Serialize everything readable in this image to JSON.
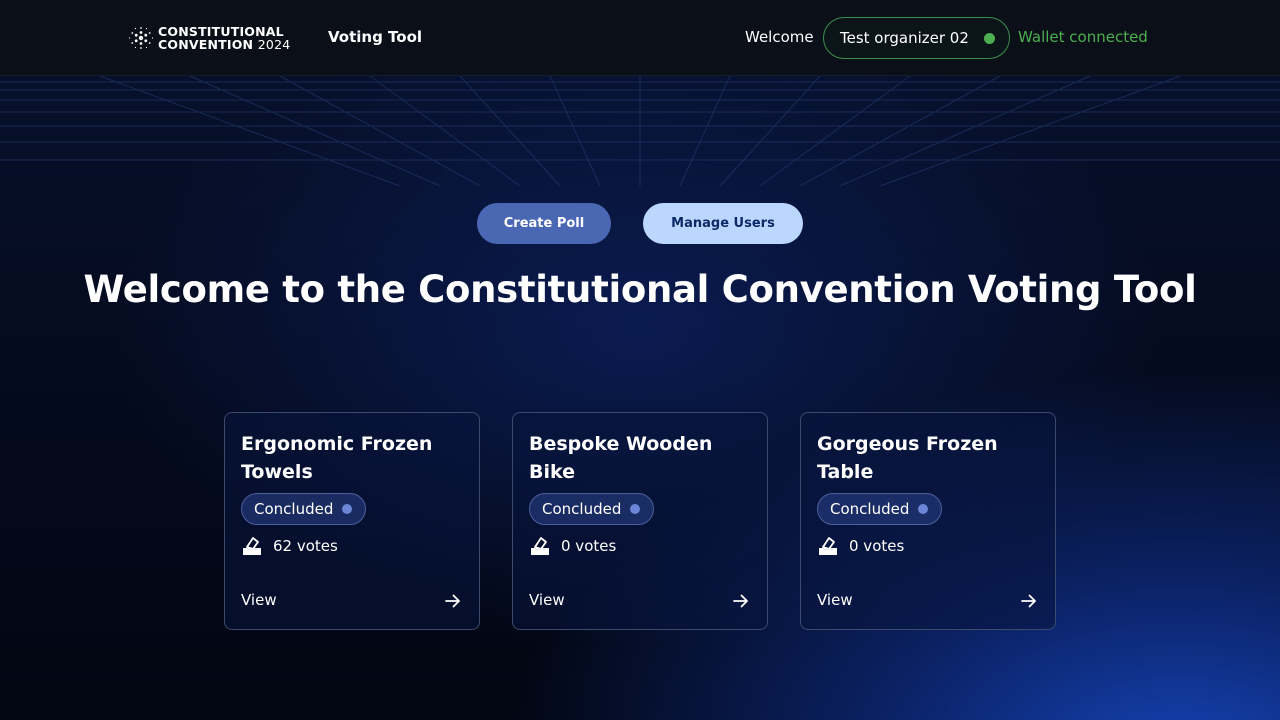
{
  "header": {
    "logo_line1": "CONSTITUTIONAL",
    "logo_line2": "CONVENTION",
    "logo_year": "2024",
    "logo_icon": "cardano-dots-icon",
    "app_title": "Voting Tool",
    "welcome_label": "Welcome",
    "user_name": "Test organizer 02",
    "wallet_status": "Wallet connected"
  },
  "actions": {
    "create_poll": "Create Poll",
    "manage_users": "Manage Users"
  },
  "main": {
    "heading": "Welcome to the Constitutional Convention Voting Tool"
  },
  "polls": [
    {
      "title": "Ergonomic Frozen Towels",
      "status": "Concluded",
      "votes": "62 votes",
      "view_label": "View"
    },
    {
      "title": "Bespoke Wooden Bike",
      "status": "Concluded",
      "votes": "0 votes",
      "view_label": "View"
    },
    {
      "title": "Gorgeous Frozen Table",
      "status": "Concluded",
      "votes": "0 votes",
      "view_label": "View"
    }
  ],
  "colors": {
    "accent_green": "#4caf50",
    "primary_button": "#4a67b4",
    "secondary_button": "#bcd7ff",
    "status_dot": "#6b86d6"
  }
}
